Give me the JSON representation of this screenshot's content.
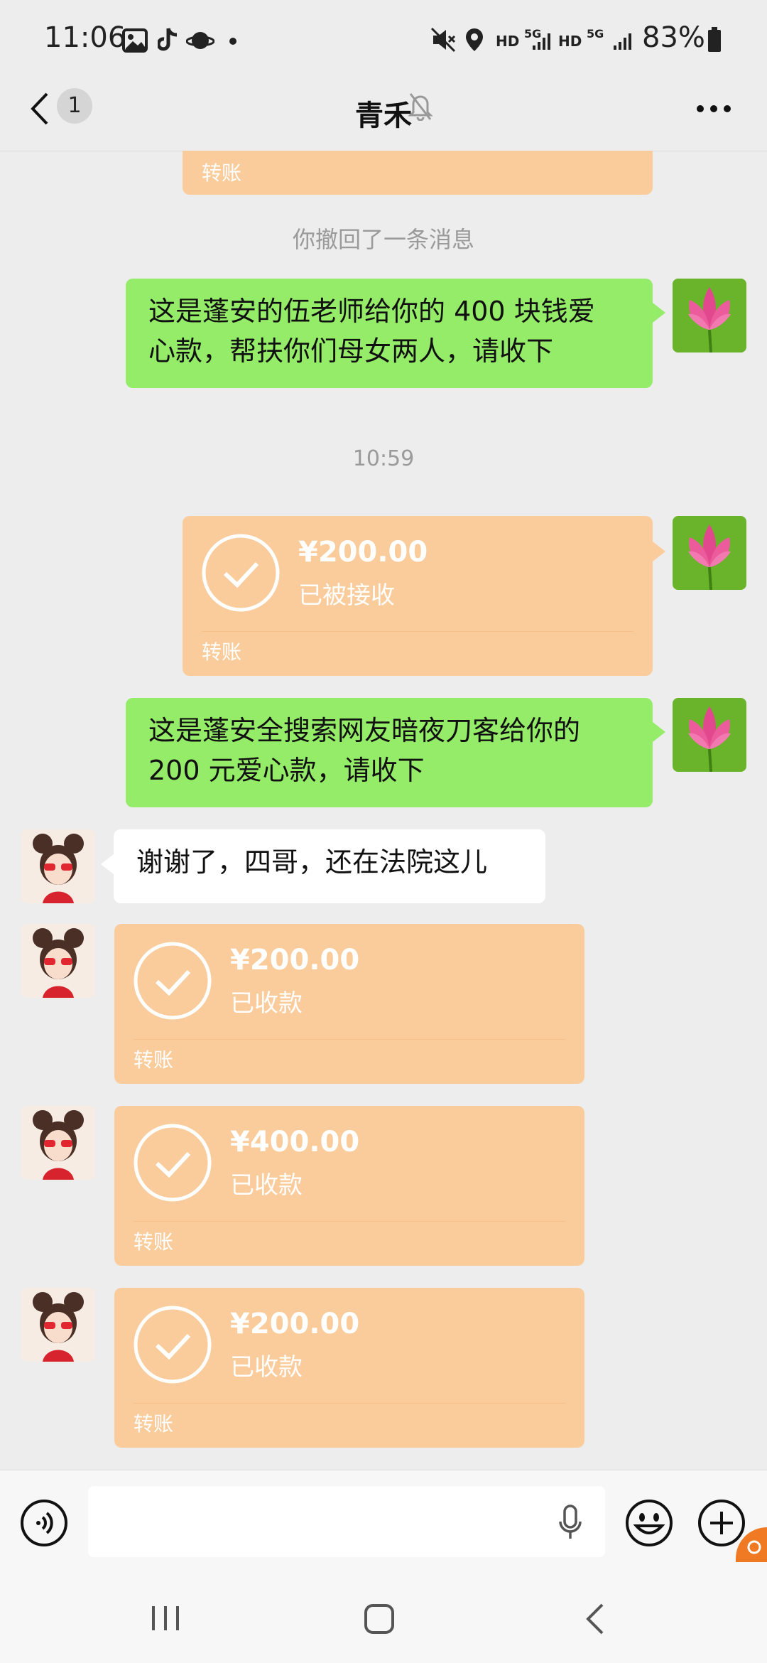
{
  "status_bar": {
    "time": "11:06",
    "battery": "83%",
    "network_labels": [
      "HD",
      "5G",
      "HD",
      "5G"
    ],
    "icons": [
      "image-icon",
      "tiktok-icon",
      "planet-icon",
      "dot-icon",
      "mute-icon",
      "location-icon",
      "signal-icon",
      "battery-icon"
    ]
  },
  "nav": {
    "back_badge": "1",
    "title": "青禾",
    "icons": [
      "back-arrow-icon",
      "muted-bell-icon",
      "more-icon"
    ]
  },
  "chat": {
    "top_partial_transfer_label": "转账",
    "recall_notice": "你撤回了一条消息",
    "timestamp": "10:59",
    "messages": [
      {
        "type": "text",
        "side": "right",
        "lines": [
          "这是蓬安的伍老师给你的 400 块钱爱",
          "心款，帮扶你们母女两人，请收下"
        ]
      },
      {
        "type": "transfer",
        "side": "right",
        "amount": "¥200.00",
        "status": "已被接收",
        "label": "转账"
      },
      {
        "type": "text",
        "side": "right",
        "lines": [
          "这是蓬安全搜索网友暗夜刀客给你的",
          "200 元爱心款，请收下"
        ]
      },
      {
        "type": "text",
        "side": "left",
        "lines": [
          "谢谢了，四哥，还在法院这儿"
        ]
      },
      {
        "type": "transfer",
        "side": "left",
        "amount": "¥200.00",
        "status": "已收款",
        "label": "转账"
      },
      {
        "type": "transfer",
        "side": "left",
        "amount": "¥400.00",
        "status": "已收款",
        "label": "转账"
      },
      {
        "type": "transfer",
        "side": "left",
        "amount": "¥200.00",
        "status": "已收款",
        "label": "转账"
      }
    ]
  },
  "input_bar": {
    "icons": [
      "voice-icon",
      "microphone-icon",
      "emoji-icon",
      "plus-icon"
    ],
    "value": ""
  },
  "system_nav": {
    "icons": [
      "recents-icon",
      "home-icon",
      "back-icon"
    ]
  },
  "colors": {
    "background": "#ededed",
    "sent_bubble": "#95ec69",
    "received_bubble": "#ffffff",
    "transfer_card": "#fbcc9b",
    "system_text": "#9a9a9a"
  }
}
